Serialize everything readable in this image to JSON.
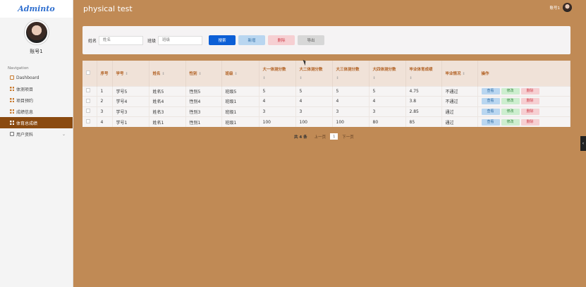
{
  "sidebar": {
    "brand": "Adminto",
    "account_name": "账号1",
    "nav_title": "Navigation",
    "items": [
      {
        "label": "Dashboard",
        "icon": "home-icon"
      },
      {
        "label": "体测项目",
        "icon": "grid-icon"
      },
      {
        "label": "项目预约",
        "icon": "grid-icon"
      },
      {
        "label": "成绩信息",
        "icon": "grid-icon"
      },
      {
        "label": "体育总成绩",
        "icon": "grid-icon",
        "active": true
      },
      {
        "label": "用户资料",
        "icon": "user-icon",
        "has_submenu": true
      }
    ]
  },
  "header": {
    "title": "physical test",
    "user_name": "账号1"
  },
  "search": {
    "name_label": "姓名",
    "name_placeholder": "姓名",
    "class_label": "班级",
    "class_placeholder": "班级",
    "search_button": "搜索",
    "add_button": "新增",
    "delete_button": "删除",
    "export_button": "导出"
  },
  "table": {
    "columns": [
      "",
      "序号",
      "学号",
      "姓名",
      "性别",
      "班级",
      "大一体测分数",
      "大二体测分数",
      "大三体测分数",
      "大四体测分数",
      "毕业体育成绩",
      "毕业情况",
      "操作"
    ],
    "sort_glyph": "⇕",
    "rows": [
      [
        "1",
        "学号5",
        "姓名5",
        "性别5",
        "班级5",
        "5",
        "5",
        "5",
        "5",
        "4.75",
        "不通过"
      ],
      [
        "2",
        "学号4",
        "姓名4",
        "性别4",
        "班级1",
        "4",
        "4",
        "4",
        "4",
        "3.8",
        "不通过"
      ],
      [
        "3",
        "学号3",
        "姓名3",
        "性别3",
        "班级1",
        "3",
        "3",
        "3",
        "3",
        "2.85",
        "通过"
      ],
      [
        "4",
        "学号1",
        "姓名1",
        "性别1",
        "班级1",
        "100",
        "100",
        "100",
        "80",
        "85",
        "通过"
      ]
    ],
    "actions": {
      "view": "查看",
      "edit": "修改",
      "delete": "删除"
    }
  },
  "pagination": {
    "total": "共 4 条",
    "prev": "上一页",
    "current": "1",
    "next": "下一页"
  },
  "colors": {
    "background": "#c08a55",
    "active_nav": "#8a4a10",
    "primary": "#0c5fd6",
    "header_text": "#b05f20"
  }
}
